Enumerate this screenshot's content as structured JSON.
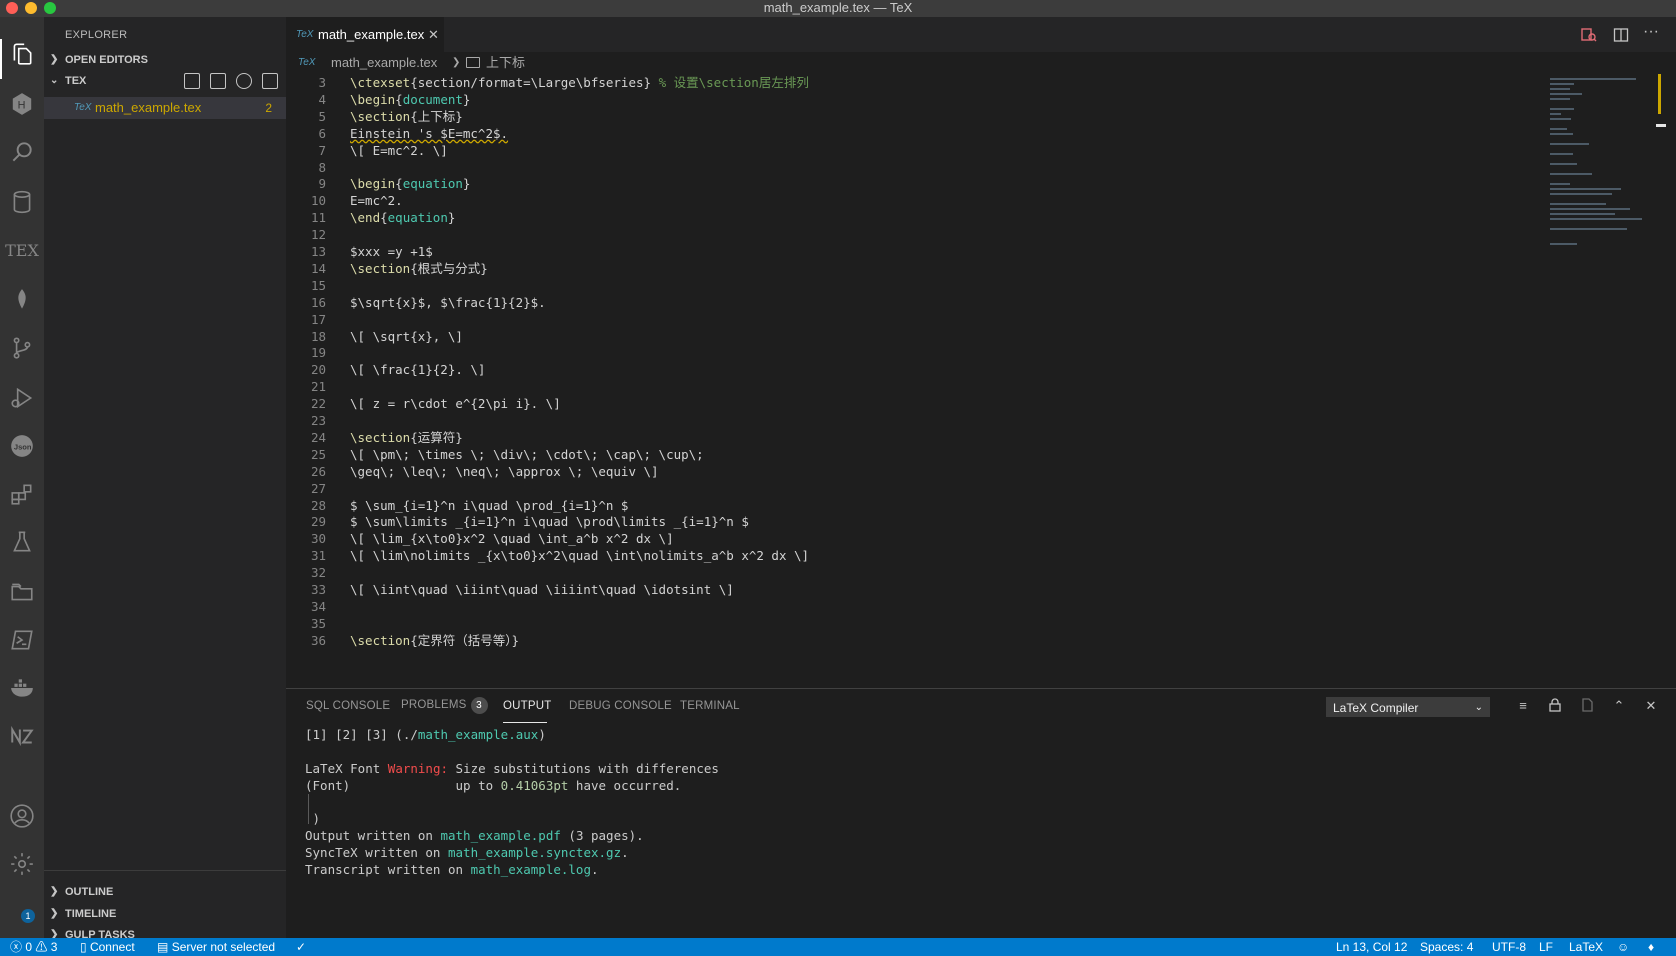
{
  "window": {
    "title": "math_example.tex — TeX"
  },
  "sidebar": {
    "title": "EXPLORER",
    "sections": {
      "open_editors": "OPEN EDITORS",
      "workspace": "TEX",
      "outline": "OUTLINE",
      "timeline": "TIMELINE",
      "gulp": "GULP TASKS"
    },
    "file": {
      "icon_label": "TeX",
      "name": "math_example.tex",
      "problems": "2"
    }
  },
  "activity_bar": {
    "settings_badge": "1"
  },
  "editor": {
    "tab": {
      "icon_label": "TeX",
      "name": "math_example.tex"
    },
    "breadcrumb": {
      "file": "math_example.tex",
      "symbol": "上下标"
    },
    "lines": [
      {
        "n": "3",
        "t": "\\ctexset{section/format=\\Large\\bfseries} % 设置\\section居左排列"
      },
      {
        "n": "4",
        "t": "\\begin{document}"
      },
      {
        "n": "5",
        "t": "\\section{上下标}"
      },
      {
        "n": "6",
        "t": "Einstein 's $E=mc^2$."
      },
      {
        "n": "7",
        "t": "\\[ E=mc^2. \\]"
      },
      {
        "n": "8",
        "t": ""
      },
      {
        "n": "9",
        "t": "\\begin{equation}"
      },
      {
        "n": "10",
        "t": "E=mc^2."
      },
      {
        "n": "11",
        "t": "\\end{equation}"
      },
      {
        "n": "12",
        "t": ""
      },
      {
        "n": "13",
        "t": "$xxx =y +1$"
      },
      {
        "n": "14",
        "t": "\\section{根式与分式}"
      },
      {
        "n": "15",
        "t": ""
      },
      {
        "n": "16",
        "t": "$\\sqrt{x}$, $\\frac{1}{2}$."
      },
      {
        "n": "17",
        "t": ""
      },
      {
        "n": "18",
        "t": "\\[ \\sqrt{x}, \\]"
      },
      {
        "n": "19",
        "t": ""
      },
      {
        "n": "20",
        "t": "\\[ \\frac{1}{2}. \\]"
      },
      {
        "n": "21",
        "t": ""
      },
      {
        "n": "22",
        "t": "\\[ z = r\\cdot e^{2\\pi i}. \\]"
      },
      {
        "n": "23",
        "t": ""
      },
      {
        "n": "24",
        "t": "\\section{运算符}"
      },
      {
        "n": "25",
        "t": "\\[ \\pm\\; \\times \\; \\div\\; \\cdot\\; \\cap\\; \\cup\\;"
      },
      {
        "n": "26",
        "t": "\\geq\\; \\leq\\; \\neq\\; \\approx \\; \\equiv \\]"
      },
      {
        "n": "27",
        "t": ""
      },
      {
        "n": "28",
        "t": "$ \\sum_{i=1}^n i\\quad \\prod_{i=1}^n $"
      },
      {
        "n": "29",
        "t": "$ \\sum\\limits _{i=1}^n i\\quad \\prod\\limits _{i=1}^n $"
      },
      {
        "n": "30",
        "t": "\\[ \\lim_{x\\to0}x^2 \\quad \\int_a^b x^2 dx \\]"
      },
      {
        "n": "31",
        "t": "\\[ \\lim\\nolimits _{x\\to0}x^2\\quad \\int\\nolimits_a^b x^2 dx \\]"
      },
      {
        "n": "32",
        "t": ""
      },
      {
        "n": "33",
        "t": "\\[ \\iint\\quad \\iiint\\quad \\iiiint\\quad \\idotsint \\]"
      },
      {
        "n": "34",
        "t": ""
      },
      {
        "n": "35",
        "t": ""
      },
      {
        "n": "36",
        "t": "\\section{定界符（括号等）}"
      }
    ]
  },
  "panel": {
    "tabs": {
      "sql": "SQL CONSOLE",
      "problems": "PROBLEMS",
      "problems_count": "3",
      "output": "OUTPUT",
      "debug": "DEBUG CONSOLE",
      "terminal": "TERMINAL"
    },
    "channel": "LaTeX Compiler",
    "output": {
      "l1_pre": "[1] [2] [3] (./",
      "l1_file": "math_example.aux",
      "l1_post": ")",
      "l2_pre": "LaTeX Font ",
      "l2_warn": "Warning:",
      "l2_post": " Size substitutions with differences",
      "l3_pre": "(Font)              up to ",
      "l3_num": "0.41063pt",
      "l3_post": " have occurred.",
      "l4": " )",
      "l5_pre": "Output written on ",
      "l5_file": "math_example.pdf",
      "l5_post": " (3 pages).",
      "l6_pre": "SyncTeX written on ",
      "l6_file": "math_example.synctex.gz",
      "l6_post": ".",
      "l7_pre": "Transcript written on ",
      "l7_file": "math_example.log",
      "l7_post": "."
    }
  },
  "statusbar": {
    "errors": "0",
    "warnings": "3",
    "connect": "Connect",
    "server": "Server not selected",
    "position": "Ln 13, Col 12",
    "spaces": "Spaces: 4",
    "encoding": "UTF-8",
    "eol": "LF",
    "language": "LaTeX"
  }
}
